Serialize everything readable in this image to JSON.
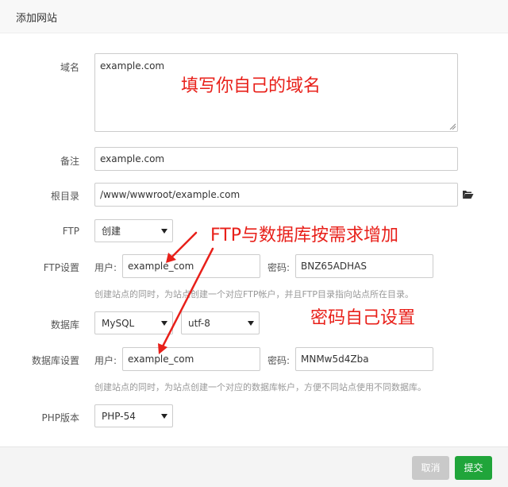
{
  "dialog": {
    "title": "添加网站"
  },
  "form": {
    "domain": {
      "label": "域名",
      "value": "example.com"
    },
    "remark": {
      "label": "备注",
      "value": "example.com"
    },
    "root": {
      "label": "根目录",
      "value": "/www/wwwroot/example.com",
      "icon": "folder-open-icon"
    },
    "ftp": {
      "label": "FTP",
      "selected": "创建"
    },
    "ftp_settings": {
      "label": "FTP设置",
      "user_label": "用户:",
      "user_value": "example_com",
      "pass_label": "密码:",
      "pass_value": "BNZ65ADHAS",
      "hint": "创建站点的同时，为站点创建一个对应FTP帐户，并且FTP目录指向站点所在目录。"
    },
    "database": {
      "label": "数据库",
      "type_selected": "MySQL",
      "charset_selected": "utf-8"
    },
    "db_settings": {
      "label": "数据库设置",
      "user_label": "用户:",
      "user_value": "example_com",
      "pass_label": "密码:",
      "pass_value": "MNMw5d4Zba",
      "hint": "创建站点的同时，为站点创建一个对应的数据库帐户，方便不同站点使用不同数据库。"
    },
    "php": {
      "label": "PHP版本",
      "selected": "PHP-54"
    }
  },
  "annotations": {
    "domain_note": "填写你自己的域名",
    "ftp_db_note": "FTP与数据库按需求增加",
    "password_note": "密码自己设置"
  },
  "footer": {
    "cancel_label": "取消",
    "submit_label": "提交"
  },
  "colors": {
    "annotation": "#e8201a",
    "submit": "#20a53a",
    "cancel": "#c9c9c9"
  }
}
